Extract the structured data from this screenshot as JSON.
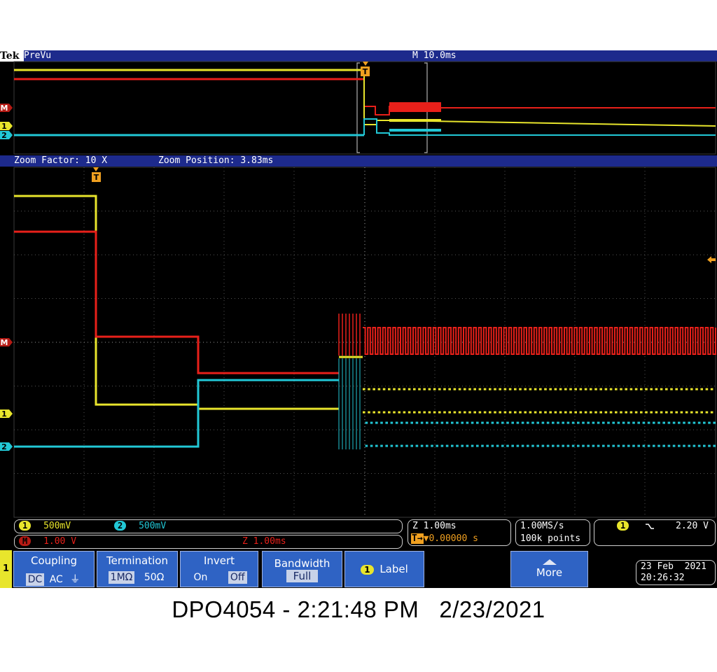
{
  "header": {
    "brand": "Tek",
    "mode": "PreVu",
    "timebase": "M 10.0ms"
  },
  "zoom": {
    "factor": "Zoom Factor: 10 X",
    "position": "Zoom Position: 3.83ms"
  },
  "markers": {
    "trigger": "T",
    "math": "M",
    "ch1": "1",
    "ch2": "2"
  },
  "channels": {
    "ch1": {
      "number": "1",
      "scale": "500mV",
      "color": "#e8e52c"
    },
    "ch2": {
      "number": "2",
      "scale": "500mV",
      "color": "#22c8d6"
    },
    "math": {
      "label": "M",
      "scale": "1.00 V",
      "zscale": "Z 1.00ms",
      "color": "#e8201a"
    }
  },
  "acq": {
    "zoom_scale": "Z 1.00ms",
    "trigger_delay": "0.00000 s",
    "sample_rate": "1.00MS/s",
    "record_length": "100k points"
  },
  "trigger": {
    "source": "1",
    "slope_icon": "falling-edge-icon",
    "level": "2.20 V"
  },
  "menu": {
    "channel": "1",
    "coupling": {
      "title": "Coupling",
      "options": [
        "DC",
        "AC",
        "⏚"
      ],
      "selected": "DC"
    },
    "termination": {
      "title": "Termination",
      "options": [
        "1MΩ",
        "50Ω"
      ],
      "selected": "1MΩ"
    },
    "invert": {
      "title": "Invert",
      "options": [
        "On",
        "Off"
      ],
      "selected": "Off"
    },
    "bandwidth": {
      "title": "Bandwidth",
      "value": "Full"
    },
    "label": {
      "channel": "1",
      "title": "Label"
    },
    "more": {
      "title": "More"
    }
  },
  "datetime": {
    "date": "23 Feb  2021",
    "time": "20:26:32"
  },
  "caption": "DPO4054 - 2:21:48 PM   2/23/2021"
}
